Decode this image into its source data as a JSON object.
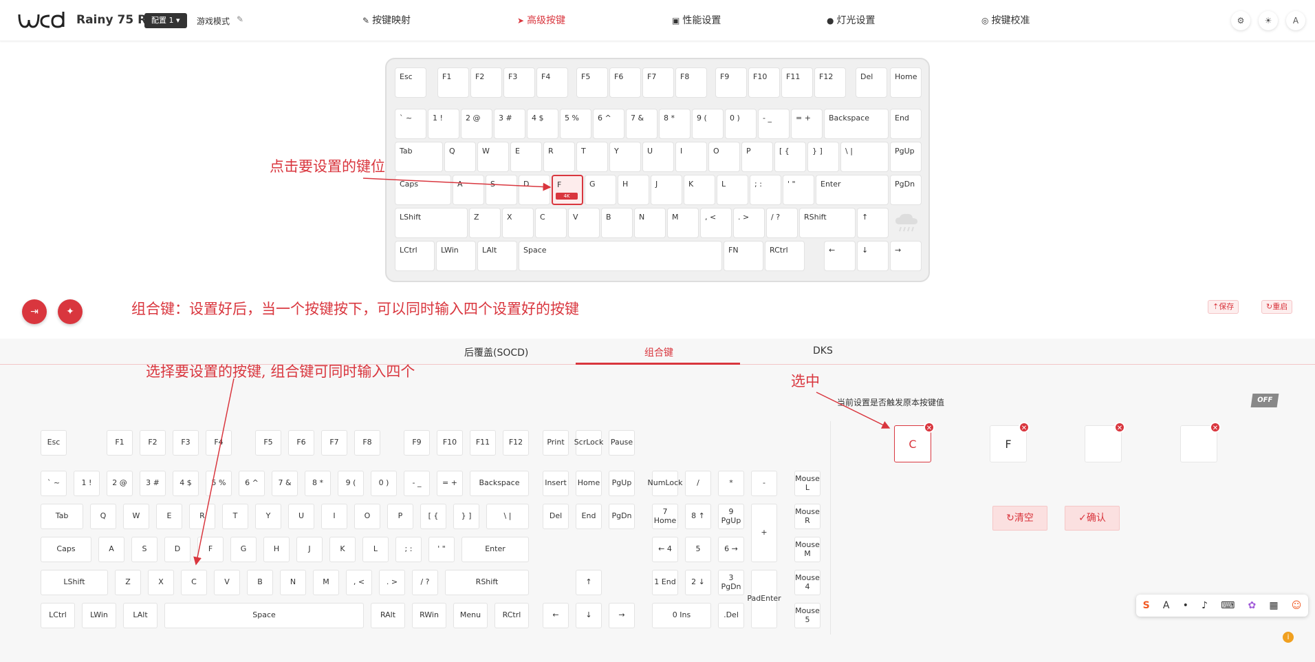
{
  "header": {
    "logo": "wcd-logo",
    "device_name": "Rainy 75 RT",
    "config_button": "配置 1",
    "game_mode": "游戏模式",
    "nav": [
      {
        "label": "按键映射",
        "icon": "pen-icon",
        "active": false
      },
      {
        "label": "高级按键",
        "icon": "send-icon",
        "active": true
      },
      {
        "label": "性能设置",
        "icon": "gauge-icon",
        "active": false
      },
      {
        "label": "灯光设置",
        "icon": "bulb-icon",
        "active": false
      },
      {
        "label": "按键校准",
        "icon": "target-icon",
        "active": false
      }
    ],
    "user_initial": "A"
  },
  "keyboard": {
    "selected_key": "F",
    "selected_tag": "4K",
    "rows": [
      [
        "Esc",
        "F1",
        "F2",
        "F3",
        "F4",
        "F5",
        "F6",
        "F7",
        "F8",
        "F9",
        "F10",
        "F11",
        "F12",
        "Del",
        "Home"
      ],
      [
        "` ~",
        "1 !",
        "2 @",
        "3 #",
        "4 $",
        "5 %",
        "6 ^",
        "7 &",
        "8 *",
        "9 (",
        "0 )",
        "- _",
        "= +",
        "Backspace",
        "End"
      ],
      [
        "Tab",
        "Q",
        "W",
        "E",
        "R",
        "T",
        "Y",
        "U",
        "I",
        "O",
        "P",
        "[ {",
        "} ]",
        "\\ |",
        "PgUp"
      ],
      [
        "Caps",
        "A",
        "S",
        "D",
        "F",
        "G",
        "H",
        "J",
        "K",
        "L",
        "; :",
        "' \"",
        "Enter",
        "PgDn"
      ],
      [
        "LShift",
        "Z",
        "X",
        "C",
        "V",
        "B",
        "N",
        "M",
        ", <",
        ". >",
        "/ ?",
        "RShift",
        "↑"
      ],
      [
        "LCtrl",
        "LWin",
        "LAlt",
        "Space",
        "FN",
        "RCtrl",
        "←",
        "↓",
        "→"
      ]
    ]
  },
  "annotations": {
    "click_key": "点击要设置的键位",
    "combo_desc": "组合键：设置好后，当一个按键按下，可以同时输入四个设置好的按键",
    "choose_keys": "选择要设置的按键, 组合键可同时输入四个",
    "selected": "选中"
  },
  "actions": {
    "save": "保存",
    "reset": "重启"
  },
  "tabs": [
    {
      "label": "后覆盖(SOCD)",
      "active": false
    },
    {
      "label": "组合键",
      "active": true
    },
    {
      "label": "DKS",
      "active": false
    }
  ],
  "combo": {
    "trigger_question": "当前设置是否触发原本按键值",
    "toggle": "OFF",
    "slots": [
      "C",
      "F",
      "",
      ""
    ],
    "clear": "清空",
    "confirm": "确认"
  },
  "picker": {
    "fn_row": [
      "Esc",
      "F1",
      "F2",
      "F3",
      "F4",
      "F5",
      "F6",
      "F7",
      "F8",
      "F9",
      "F10",
      "F11",
      "F12"
    ],
    "num_row": [
      "` ~",
      "1 !",
      "2 @",
      "3 #",
      "4 $",
      "5 %",
      "6 ^",
      "7 &",
      "8 *",
      "9 (",
      "0 )",
      "- _",
      "= +",
      "Backspace"
    ],
    "q_row": [
      "Tab",
      "Q",
      "W",
      "E",
      "R",
      "T",
      "Y",
      "U",
      "I",
      "O",
      "P",
      "[ {",
      "} ]",
      "\\ |"
    ],
    "a_row": [
      "Caps",
      "A",
      "S",
      "D",
      "F",
      "G",
      "H",
      "J",
      "K",
      "L",
      "; :",
      "' \"",
      "Enter"
    ],
    "z_row": [
      "LShift",
      "Z",
      "X",
      "C",
      "V",
      "B",
      "N",
      "M",
      ", <",
      ". >",
      "/ ?",
      "RShift"
    ],
    "bottom_row": [
      "LCtrl",
      "LWin",
      "LAlt",
      "Space",
      "RAlt",
      "RWin",
      "Menu",
      "RCtrl"
    ],
    "nav_cluster": [
      "Print",
      "ScrLock",
      "Pause",
      "Insert",
      "Home",
      "PgUp",
      "Del",
      "End",
      "PgDn",
      "↑",
      "←",
      "↓",
      "→"
    ],
    "numpad": [
      "NumLock",
      "/",
      "*",
      "-",
      "7 Home",
      "8 ↑",
      "9 PgUp",
      "+",
      "← 4",
      "5",
      "6 →",
      "1 End",
      "2 ↓",
      "3 PgDn",
      "PadEnter",
      "0 Ins",
      ".Del"
    ],
    "mouse": [
      "Mouse L",
      "Mouse R",
      "Mouse M",
      "Mouse 4",
      "Mouse 5"
    ]
  }
}
